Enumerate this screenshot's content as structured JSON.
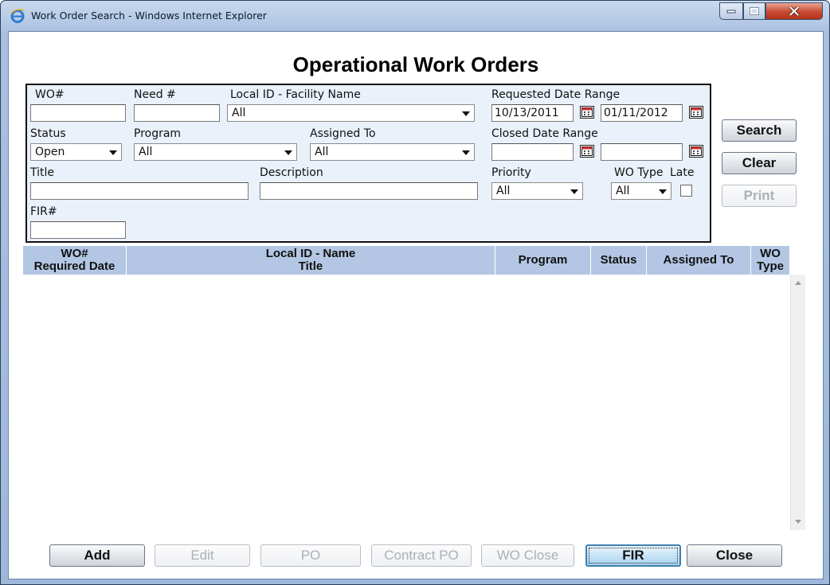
{
  "window": {
    "title": "Work Order Search - Windows Internet Explorer",
    "accent": "#c8492f"
  },
  "page": {
    "title": "Operational Work Orders"
  },
  "filters": {
    "wo_label": "WO#",
    "wo_value": "",
    "need_label": "Need #",
    "need_value": "",
    "facility_label": "Local ID - Facility Name",
    "facility_value": "All",
    "requested_label": "Requested Date Range",
    "requested_from": "10/13/2011",
    "requested_to": "01/11/2012",
    "status_label": "Status",
    "status_value": "Open",
    "program_label": "Program",
    "program_value": "All",
    "assigned_label": "Assigned To",
    "assigned_value": "All",
    "closed_label": "Closed Date Range",
    "closed_from": "",
    "closed_to": "",
    "title_label": "Title",
    "title_value": "",
    "description_label": "Description",
    "description_value": "",
    "priority_label": "Priority",
    "priority_value": "All",
    "wotype_label": "WO Type",
    "wotype_value": "All",
    "late_label": "Late",
    "late_checked": false,
    "fir_label": "FIR#",
    "fir_value": ""
  },
  "side_buttons": {
    "search": "Search",
    "clear": "Clear",
    "print": "Print"
  },
  "grid": {
    "columns": [
      {
        "line1": "WO#",
        "line2": "Required Date"
      },
      {
        "line1": "Local ID - Name",
        "line2": "Title"
      },
      {
        "line1": "Program",
        "line2": ""
      },
      {
        "line1": "Status",
        "line2": ""
      },
      {
        "line1": "Assigned To",
        "line2": ""
      },
      {
        "line1": "WO",
        "line2": "Type"
      }
    ],
    "rows": []
  },
  "bottom_buttons": {
    "add": "Add",
    "edit": "Edit",
    "po": "PO",
    "contract_po": "Contract PO",
    "wo_close": "WO Close",
    "fir": "FIR",
    "close": "Close"
  },
  "icons": {
    "app": "ie-icon",
    "calendar": "calendar-icon",
    "dropdown": "chevron-down-icon"
  }
}
